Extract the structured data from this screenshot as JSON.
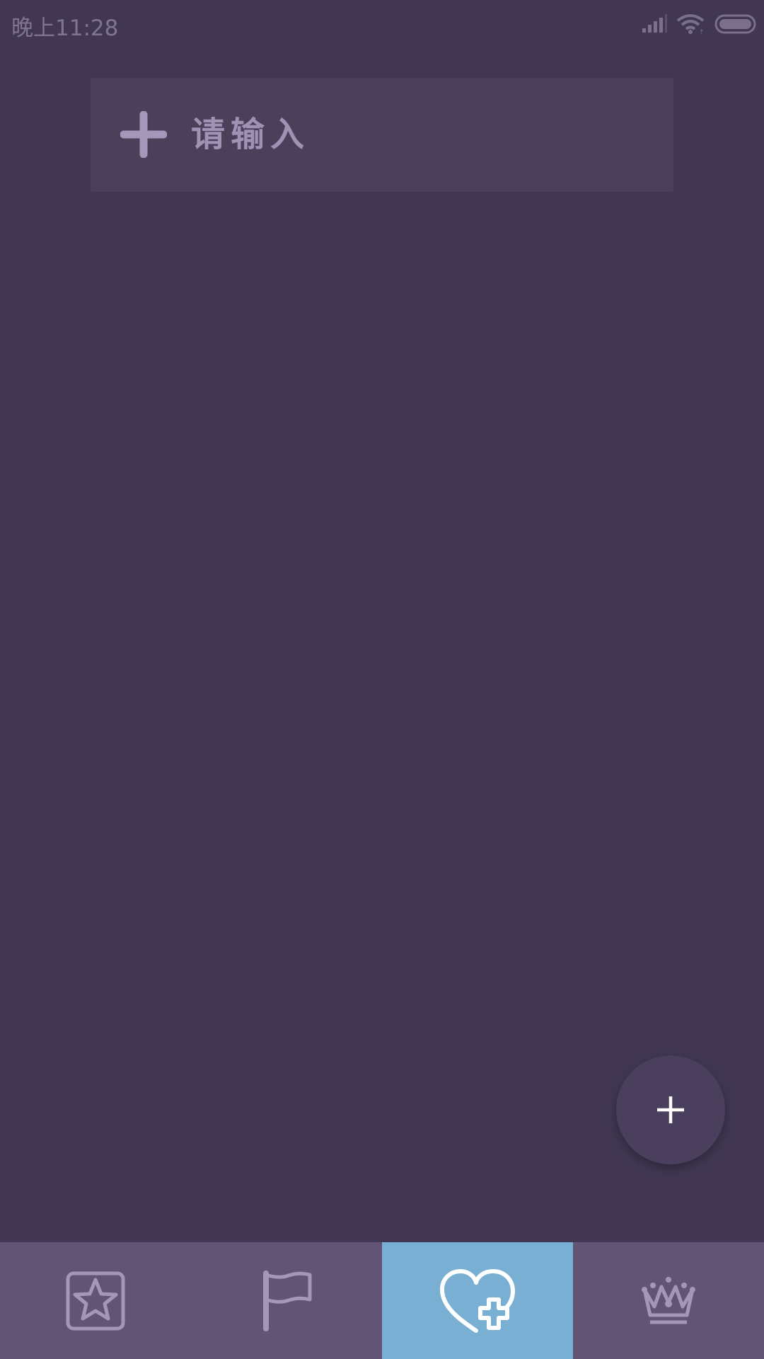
{
  "status_bar": {
    "time": "晚上11:28",
    "icons": [
      "signal-icon",
      "wifi-icon",
      "battery-icon"
    ]
  },
  "input_card": {
    "label": "请输入",
    "icon": "plus-icon"
  },
  "fab": {
    "icon": "plus-icon"
  },
  "bottom_nav": {
    "items": [
      {
        "icon": "star-icon",
        "active": false
      },
      {
        "icon": "flag-icon",
        "active": false
      },
      {
        "icon": "heart-plus-icon",
        "active": true
      },
      {
        "icon": "crown-icon",
        "active": false
      }
    ]
  },
  "colors": {
    "background": "#413752",
    "card": "#4b4059",
    "nav_background": "#625474",
    "nav_active": "#79afd3",
    "icon_muted": "#a597b9",
    "fab": "#4a3f5c"
  }
}
